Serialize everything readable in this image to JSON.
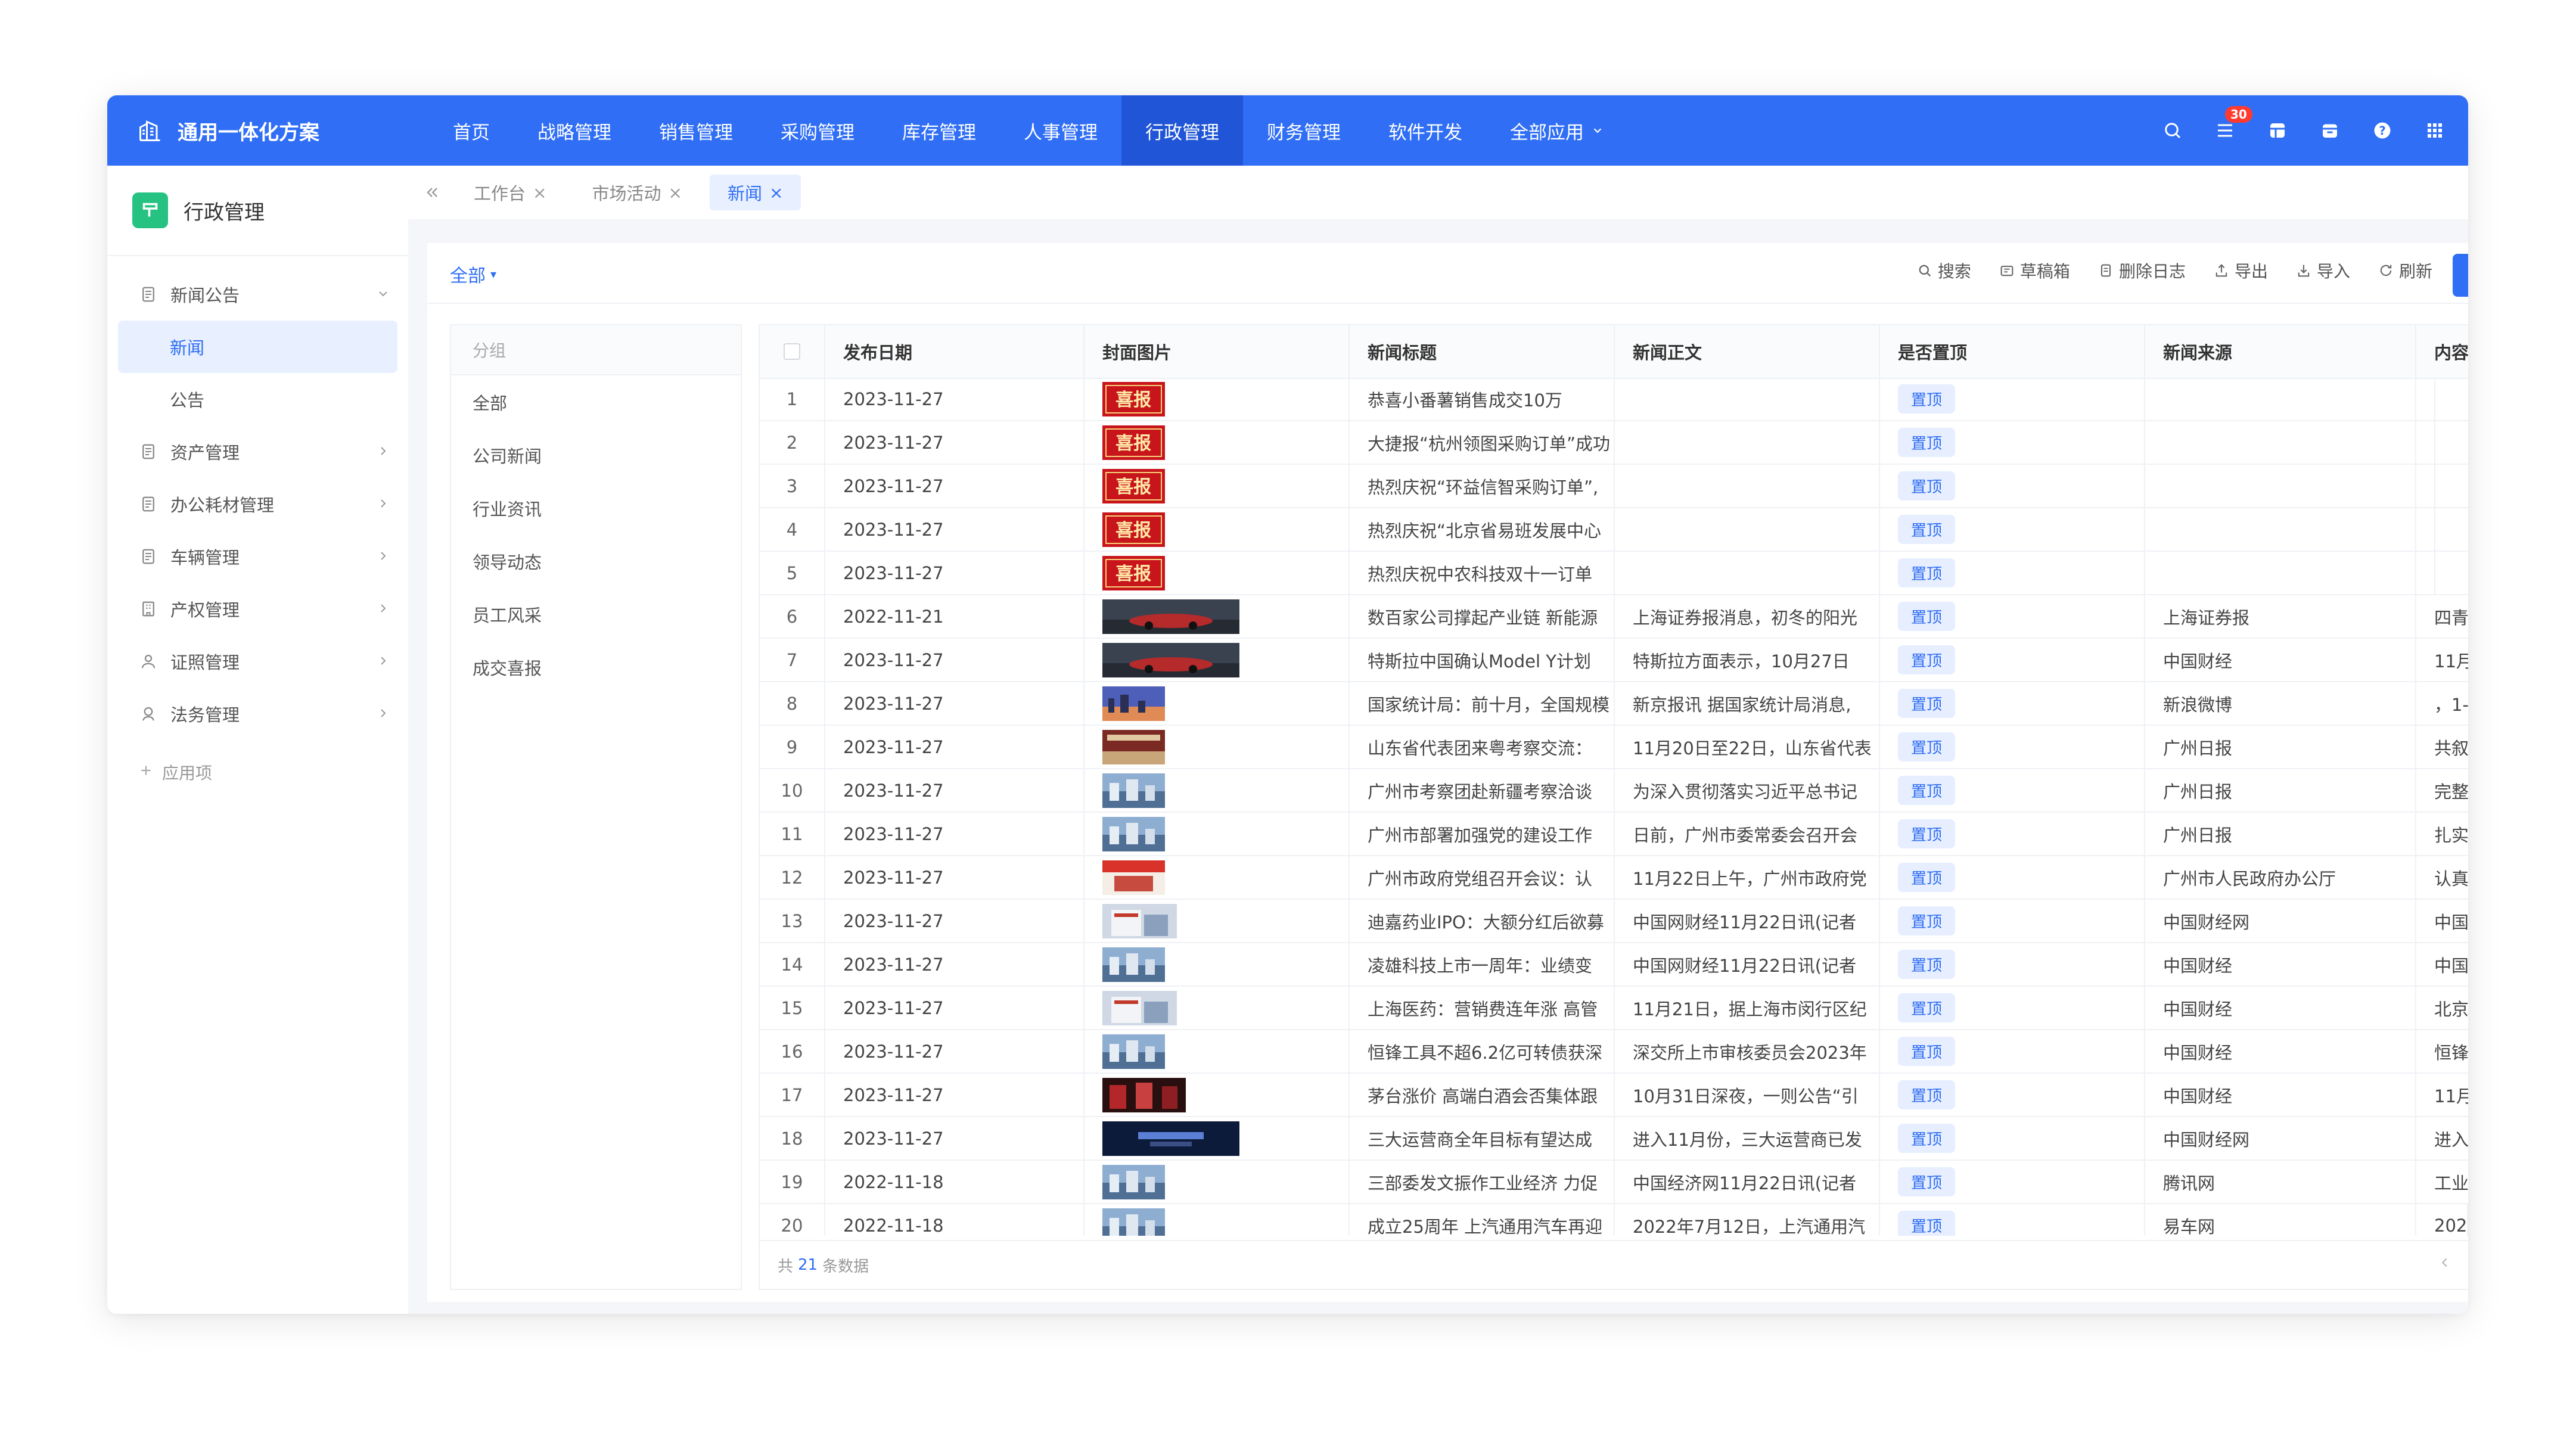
{
  "app": {
    "title": "通用一体化方案"
  },
  "nav": [
    {
      "label": "首页",
      "active": false
    },
    {
      "label": "战略管理",
      "active": false
    },
    {
      "label": "销售管理",
      "active": false
    },
    {
      "label": "采购管理",
      "active": false
    },
    {
      "label": "库存管理",
      "active": false
    },
    {
      "label": "人事管理",
      "active": false
    },
    {
      "label": "行政管理",
      "active": true
    },
    {
      "label": "财务管理",
      "active": false
    },
    {
      "label": "软件开发",
      "active": false
    },
    {
      "label": "全部应用",
      "active": false,
      "dropdown": true
    }
  ],
  "top_icons": [
    {
      "name": "search-icon"
    },
    {
      "name": "todo-icon",
      "badge": "30"
    },
    {
      "name": "grid-card-icon"
    },
    {
      "name": "calendar-icon"
    },
    {
      "name": "help-icon"
    },
    {
      "name": "apps-icon"
    }
  ],
  "sidebar": {
    "title": "行政管理",
    "items": [
      {
        "label": "新闻公告",
        "icon": "doc-icon",
        "expanded": true,
        "children": [
          {
            "label": "新闻",
            "active": true
          },
          {
            "label": "公告",
            "active": false
          }
        ]
      },
      {
        "label": "资产管理",
        "icon": "doc-icon"
      },
      {
        "label": "办公耗材管理",
        "icon": "doc-icon"
      },
      {
        "label": "车辆管理",
        "icon": "doc-icon"
      },
      {
        "label": "产权管理",
        "icon": "building-icon"
      },
      {
        "label": "证照管理",
        "icon": "user-icon"
      },
      {
        "label": "法务管理",
        "icon": "legal-icon"
      }
    ],
    "add_label": "应用项"
  },
  "tabs": [
    {
      "label": "工作台",
      "active": false
    },
    {
      "label": "市场活动",
      "active": false
    },
    {
      "label": "新闻",
      "active": true
    }
  ],
  "toolbar": {
    "filter_label": "全部",
    "actions": [
      {
        "label": "搜索",
        "icon": "search-icon"
      },
      {
        "label": "草稿箱",
        "icon": "draft-icon"
      },
      {
        "label": "删除日志",
        "icon": "log-icon"
      },
      {
        "label": "导出",
        "icon": "export-icon"
      },
      {
        "label": "导入",
        "icon": "import-icon"
      },
      {
        "label": "刷新",
        "icon": "refresh-icon"
      }
    ]
  },
  "groups": {
    "header": "分组",
    "items": [
      "全部",
      "公司新闻",
      "行业资讯",
      "领导动态",
      "员工风采",
      "成交喜报"
    ]
  },
  "table": {
    "columns": [
      "发布日期",
      "封面图片",
      "新闻标题",
      "新闻正文",
      "是否置顶",
      "新闻来源",
      "内容"
    ],
    "top_label": "置顶",
    "rows": [
      {
        "n": "1",
        "date": "2023-11-27",
        "cover": "red",
        "title": "恭喜小番薯销售成交10万",
        "body": "",
        "source": "",
        "content": ""
      },
      {
        "n": "2",
        "date": "2023-11-27",
        "cover": "red",
        "title": "大捷报“杭州领图采购订单”成功",
        "body": "",
        "source": "",
        "content": ""
      },
      {
        "n": "3",
        "date": "2023-11-27",
        "cover": "red",
        "title": "热烈庆祝“环益信智采购订单”,",
        "body": "",
        "source": "",
        "content": ""
      },
      {
        "n": "4",
        "date": "2023-11-27",
        "cover": "red",
        "title": "热烈庆祝“北京省易班发展中心",
        "body": "",
        "source": "",
        "content": ""
      },
      {
        "n": "5",
        "date": "2023-11-27",
        "cover": "red",
        "title": "热烈庆祝中农科技双十一订单",
        "body": "",
        "source": "",
        "content": ""
      },
      {
        "n": "6",
        "date": "2022-11-21",
        "cover": "car",
        "title": "数百家公司撑起产业链 新能源",
        "body": "上海证券报消息，初冬的阳光",
        "source": "上海证券报",
        "content": "四青"
      },
      {
        "n": "7",
        "date": "2023-11-27",
        "cover": "car",
        "title": "特斯拉中国确认Model Y计划",
        "body": "特斯拉方面表示，10月27日",
        "source": "中国财经",
        "content": "11月"
      },
      {
        "n": "8",
        "date": "2023-11-27",
        "cover": "dusk",
        "title": "国家统计局：前十月，全国规模",
        "body": "新京报讯 据国家统计局消息,",
        "source": "新浪微博",
        "content": "，1-"
      },
      {
        "n": "9",
        "date": "2023-11-27",
        "cover": "hall",
        "title": "山东省代表团来粤考察交流：",
        "body": "11月20日至22日，山东省代表",
        "source": "广州日报",
        "content": "共叙"
      },
      {
        "n": "10",
        "date": "2023-11-27",
        "cover": "city",
        "title": "广州市考察团赴新疆考察洽谈",
        "body": "为深入贯彻落实习近平总书记",
        "source": "广州日报",
        "content": "完整"
      },
      {
        "n": "11",
        "date": "2023-11-27",
        "cover": "city",
        "title": "广州市部署加强党的建设工作",
        "body": "日前，广州市委常委会召开会",
        "source": "广州日报",
        "content": "扎实"
      },
      {
        "n": "12",
        "date": "2023-11-27",
        "cover": "flag",
        "title": "广州市政府党组召开会议：认",
        "body": "11月22日上午，广州市政府党",
        "source": "广州市人民政府办公厅",
        "content": "认真"
      },
      {
        "n": "13",
        "date": "2023-11-27",
        "cover": "bldg",
        "title": "迪嘉药业IPO：大额分红后欲募",
        "body": "中国网财经11月22日讯(记者",
        "source": "中国财经网",
        "content": "中国"
      },
      {
        "n": "14",
        "date": "2023-11-27",
        "cover": "city",
        "title": "凌雄科技上市一周年：业绩变",
        "body": "中国网财经11月22日讯(记者",
        "source": "中国财经",
        "content": "中国"
      },
      {
        "n": "15",
        "date": "2023-11-27",
        "cover": "bldg",
        "title": "上海医药：营销费连年涨 高管",
        "body": "11月21日，据上海市闵行区纪",
        "source": "中国财经",
        "content": "北京"
      },
      {
        "n": "16",
        "date": "2023-11-27",
        "cover": "city",
        "title": "恒锋工具不超6.2亿可转债获深",
        "body": "深交所上市审核委员会2023年",
        "source": "中国财经",
        "content": "恒锋"
      },
      {
        "n": "17",
        "date": "2023-11-27",
        "cover": "wine",
        "title": "茅台涨价 高端白酒会否集体跟",
        "body": "10月31日深夜，一则公告“引",
        "source": "中国财经",
        "content": "11月"
      },
      {
        "n": "18",
        "date": "2023-11-27",
        "cover": "dark",
        "title": "三大运营商全年目标有望达成",
        "body": "进入11月份，三大运营商已发",
        "source": "中国财经网",
        "content": "进入"
      },
      {
        "n": "19",
        "date": "2022-11-18",
        "cover": "city",
        "title": "三部委发文振作工业经济 力促",
        "body": "中国经济网11月22日讯(记者",
        "source": "腾讯网",
        "content": "工业"
      },
      {
        "n": "20",
        "date": "2022-11-18",
        "cover": "city",
        "title": "成立25周年 上汽通用汽车再迎",
        "body": "2022年7月12日，上汽通用汽",
        "source": "易车网",
        "content": "202"
      }
    ],
    "footer_prefix": "共",
    "footer_count": "21",
    "footer_suffix": "条数据"
  }
}
